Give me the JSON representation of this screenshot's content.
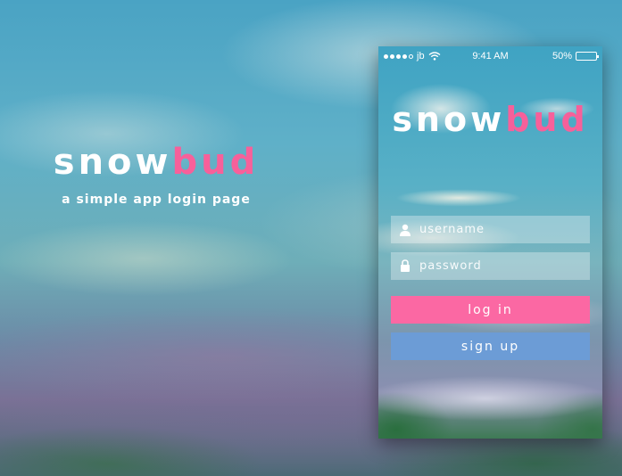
{
  "brand": {
    "logo_main": "snow",
    "logo_accent": "bud",
    "tagline": "a simple app login page"
  },
  "status_bar": {
    "carrier": "jb",
    "time": "9:41 AM",
    "battery_percent": "50%",
    "battery_level": 0.5
  },
  "app": {
    "logo_main": "snow",
    "logo_accent": "bud",
    "username_placeholder": "username",
    "password_placeholder": "password",
    "login_label": "log in",
    "signup_label": "sign up"
  },
  "colors": {
    "accent_pink": "#f7609a",
    "login_button": "#fb68a3",
    "signup_button": "#6c9cd6",
    "battery": "#f2c21c"
  },
  "icons": {
    "username": "user-icon",
    "password": "lock-icon",
    "wifi": "wifi-icon",
    "battery": "battery-icon"
  }
}
